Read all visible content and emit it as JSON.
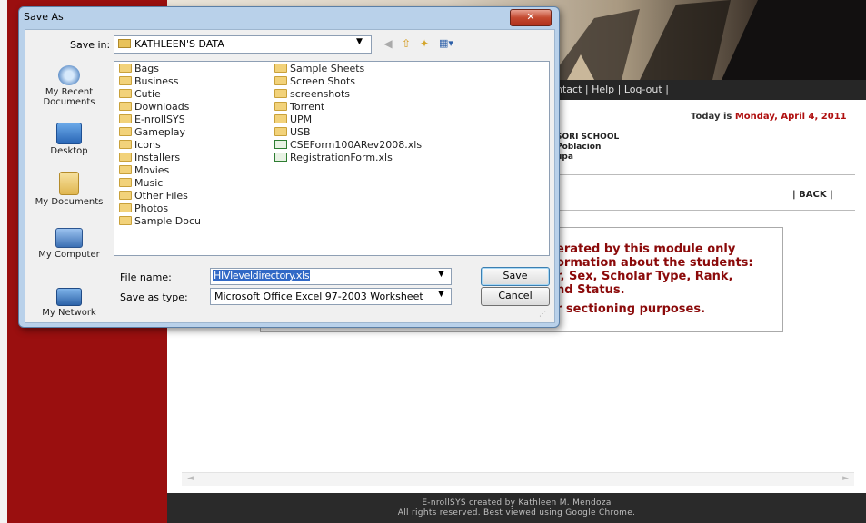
{
  "webpage": {
    "nav_links": "ntact | Help | Log-out |",
    "date_prefix": "Today is ",
    "date_value": "Monday, April 4, 2011",
    "school_lines": [
      "SORI SCHOOL",
      "Poblacion",
      "upa"
    ],
    "back_link": "| BACK |",
    "info_lines": [
      "erated by this module only",
      "ormation about the students:",
      "r, Sex, Scholar Type, Rank,",
      "nd Status."
    ],
    "info_note": "r sectioning purposes.",
    "footer_line1": "E-nrollSYS created by Kathleen M. Mendoza",
    "footer_line2": "All rights reserved. Best viewed using Google Chrome."
  },
  "dialog": {
    "title": "Save As",
    "close_label": "✕",
    "save_in_label": "Save in:",
    "save_in_value": "KATHLEEN'S DATA",
    "places": [
      "My Recent Documents",
      "Desktop",
      "My Documents",
      "My Computer",
      "My Network"
    ],
    "folders_col1": [
      "Bags",
      "Business",
      "Cutie",
      "Downloads",
      "E-nrollSYS",
      "Gameplay",
      "Icons",
      "Installers",
      "Movies",
      "Music",
      "Other Files",
      "Photos",
      "Sample Docu"
    ],
    "folders_col2": [
      "Sample Sheets",
      "Screen Shots",
      "screenshots",
      "Torrent",
      "UPM",
      "USB"
    ],
    "files_col2": [
      "CSEForm100ARev2008.xls",
      "RegistrationForm.xls"
    ],
    "file_name_label": "File name:",
    "file_name_value": "HIVleveldirectory.xls",
    "save_type_label": "Save as type:",
    "save_type_value": "Microsoft Office Excel 97-2003 Worksheet",
    "save_button": "Save",
    "cancel_button": "Cancel"
  }
}
